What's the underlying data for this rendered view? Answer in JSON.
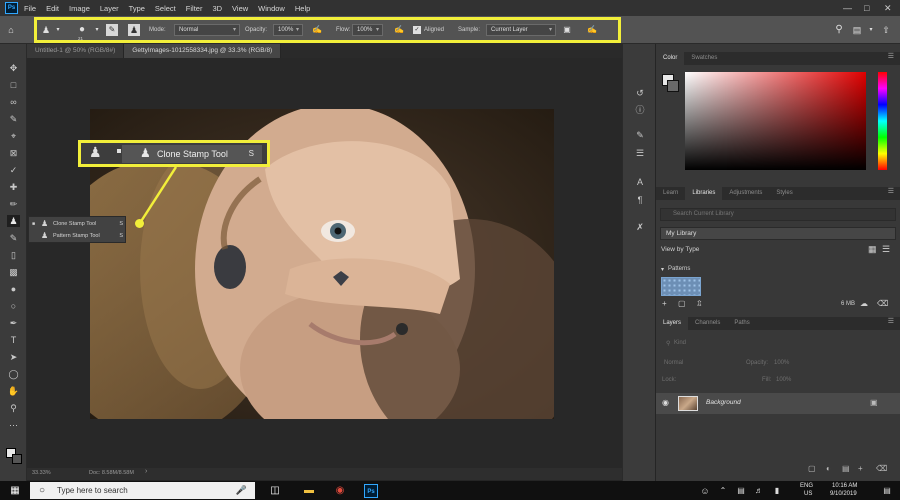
{
  "app": {
    "logo": "Ps"
  },
  "menu": [
    "File",
    "Edit",
    "Image",
    "Layer",
    "Type",
    "Select",
    "Filter",
    "3D",
    "View",
    "Window",
    "Help"
  ],
  "options_bar": {
    "brush_size": "21",
    "mode_label": "Mode:",
    "mode_value": "Normal",
    "opacity_label": "Opacity:",
    "opacity_value": "100%",
    "flow_label": "Flow:",
    "flow_value": "100%",
    "aligned_label": "Aligned",
    "sample_label": "Sample:",
    "sample_value": "Current Layer"
  },
  "tabs": [
    {
      "label": "Untitled-1 @ 50% (RGB/8#)",
      "active": false
    },
    {
      "label": "GettyImages-1012558334.jpg @ 33.3% (RGB/8)",
      "active": true
    }
  ],
  "flyout": {
    "items": [
      {
        "label": "Clone Stamp Tool",
        "key": "S"
      },
      {
        "label": "Pattern Stamp Tool",
        "key": "S"
      }
    ]
  },
  "callout": {
    "label": "Clone Stamp Tool",
    "key": "S"
  },
  "status": {
    "zoom": "33.33%",
    "doc": "Doc: 8.58M/8.58M"
  },
  "color_panel": {
    "tabs": [
      "Color",
      "Swatches"
    ]
  },
  "libraries_panel": {
    "tabs": [
      "Learn",
      "Libraries",
      "Adjustments",
      "Styles"
    ],
    "search_placeholder": "Search Current Library",
    "library_name": "My Library",
    "view_by": "View by Type",
    "patterns_label": "Patterns",
    "size_label": "6 MB"
  },
  "layers_panel": {
    "tabs": [
      "Layers",
      "Channels",
      "Paths"
    ],
    "kind_placeholder": "Kind",
    "blend_mode": "Normal",
    "opacity_label": "Opacity:",
    "opacity_value": "100%",
    "lock_label": "Lock:",
    "fill_label": "Fill:",
    "fill_value": "100%",
    "layer_name": "Background"
  },
  "taskbar": {
    "search_placeholder": "Type here to search",
    "lang": "ENG",
    "region": "US",
    "time": "10:16 AM",
    "date": "9/10/2019"
  },
  "colors": {
    "highlight": "#f2ef3a",
    "panel": "#383838",
    "optionsbar": "#535353"
  }
}
